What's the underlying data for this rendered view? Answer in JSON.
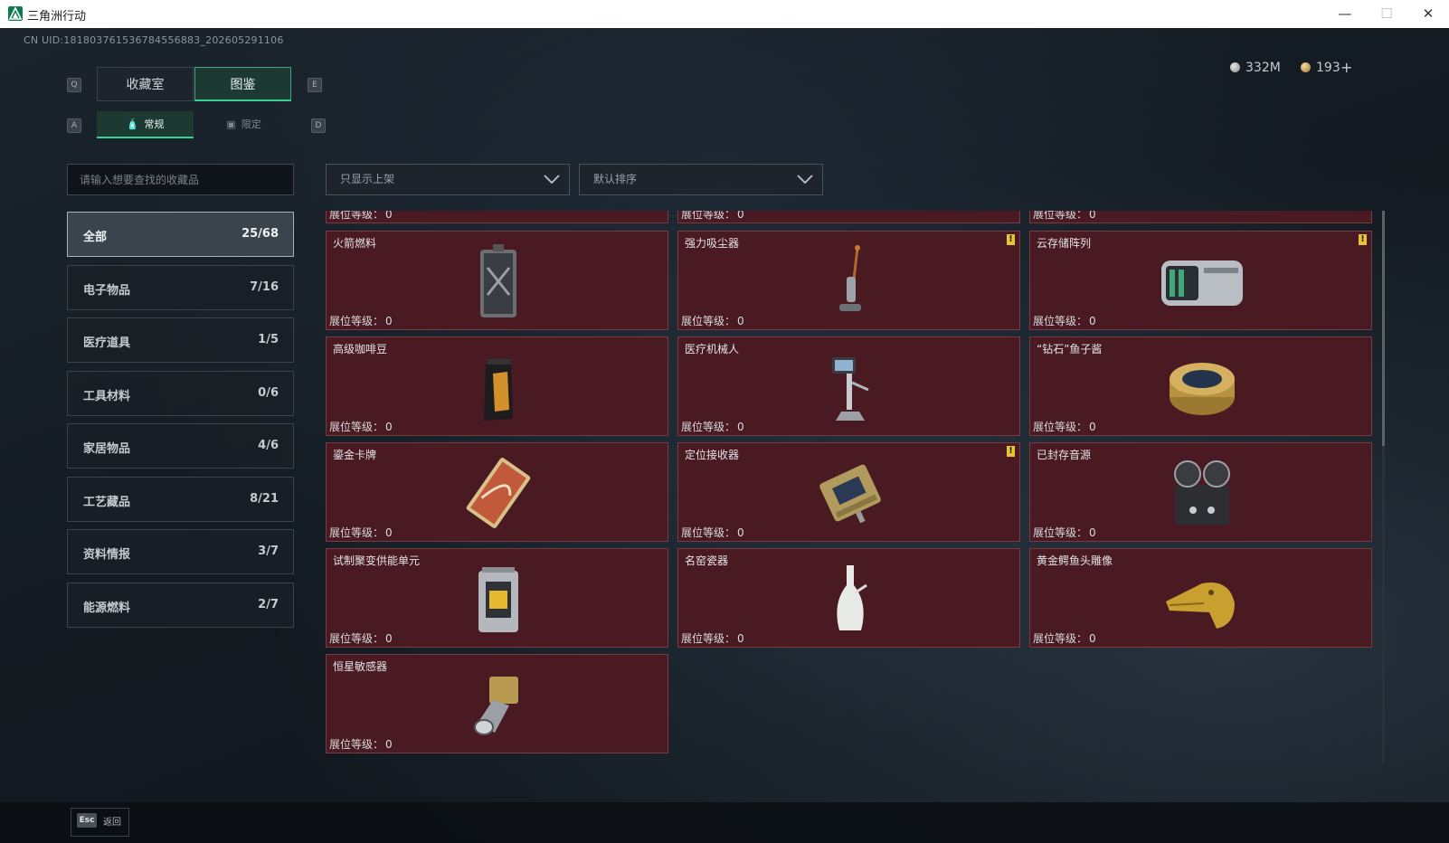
{
  "window": {
    "title": "三角洲行动",
    "minimize": "—",
    "maximize": "☐",
    "close": "✕"
  },
  "uid": "CN UID:181803761536784556883_202605291106",
  "currency": {
    "silver": "332M",
    "gold": "193",
    "add": "+"
  },
  "keys": {
    "q": "Q",
    "e": "E",
    "a": "A",
    "d": "D",
    "esc": "Esc"
  },
  "tabs": {
    "collection_room": "收藏室",
    "catalog": "图鉴"
  },
  "subtabs": {
    "regular": "常规",
    "limited": "限定"
  },
  "search": {
    "placeholder": "请输入想要查找的收藏品"
  },
  "filter": {
    "shelf": "只显示上架",
    "sort": "默认排序"
  },
  "categories": [
    {
      "label": "全部",
      "count": "25/68"
    },
    {
      "label": "电子物品",
      "count": "7/16"
    },
    {
      "label": "医疗道具",
      "count": "1/5"
    },
    {
      "label": "工具材料",
      "count": "0/6"
    },
    {
      "label": "家居物品",
      "count": "4/6"
    },
    {
      "label": "工艺藏品",
      "count": "8/21"
    },
    {
      "label": "资料情报",
      "count": "3/7"
    },
    {
      "label": "能源燃料",
      "count": "2/7"
    }
  ],
  "level_label": "展位等级：",
  "partial_row": [
    {
      "level": "0"
    },
    {
      "level": "0"
    },
    {
      "level": "0"
    }
  ],
  "items": [
    {
      "name": "火箭燃料",
      "level": "0",
      "icon": "fuel-canister-icon",
      "badge": ""
    },
    {
      "name": "强力吸尘器",
      "level": "0",
      "icon": "vacuum-cleaner-icon",
      "badge": "!"
    },
    {
      "name": "云存储阵列",
      "level": "0",
      "icon": "storage-array-icon",
      "badge": "!"
    },
    {
      "name": "高级咖啡豆",
      "level": "0",
      "icon": "coffee-bag-icon",
      "badge": ""
    },
    {
      "name": "医疗机械人",
      "level": "0",
      "icon": "medical-robot-icon",
      "badge": ""
    },
    {
      "name": "“钻石”鱼子酱",
      "level": "0",
      "icon": "caviar-tin-icon",
      "badge": ""
    },
    {
      "name": "鎏金卡牌",
      "level": "0",
      "icon": "gilded-card-icon",
      "badge": ""
    },
    {
      "name": "定位接收器",
      "level": "0",
      "icon": "gps-receiver-icon",
      "badge": "!"
    },
    {
      "name": "已封存音源",
      "level": "0",
      "icon": "reel-recorder-icon",
      "badge": ""
    },
    {
      "name": "试制聚变供能单元",
      "level": "0",
      "icon": "fusion-cell-icon",
      "badge": ""
    },
    {
      "name": "名窑瓷器",
      "level": "0",
      "icon": "porcelain-vase-icon",
      "badge": ""
    },
    {
      "name": "黄金鳄鱼头雕像",
      "level": "0",
      "icon": "gold-crocodile-icon",
      "badge": ""
    },
    {
      "name": "恒星敏感器",
      "level": "0",
      "icon": "star-sensor-icon",
      "badge": ""
    }
  ],
  "back": {
    "label": "返回"
  }
}
